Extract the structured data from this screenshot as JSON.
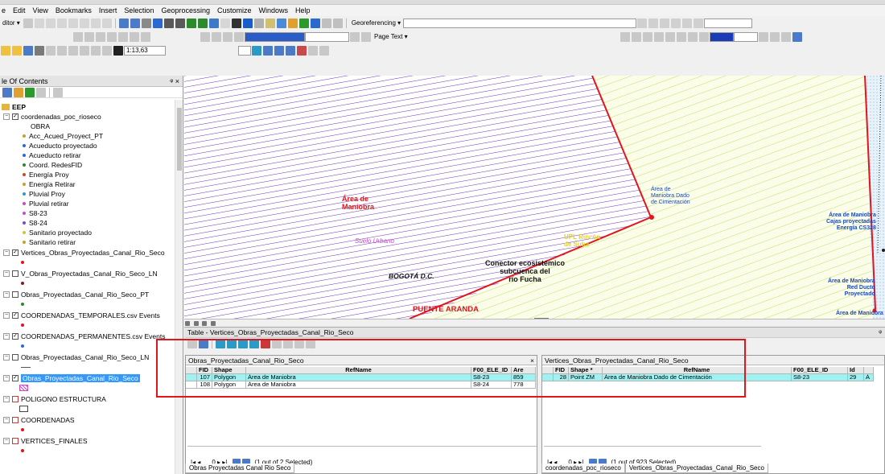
{
  "menu": [
    "e",
    "Edit",
    "View",
    "Bookmarks",
    "Insert",
    "Selection",
    "Geoprocessing",
    "Customize",
    "Windows",
    "Help"
  ],
  "toolbars": {
    "editor_label": "ditor ▾",
    "georef_label": "Georeferencing ▾",
    "page_text_label": "Page Text ▾",
    "scale": "1:13,63"
  },
  "toc": {
    "title": "le Of Contents",
    "pin": "ᵠ ×",
    "items": [
      {
        "text": "EEP"
      },
      {
        "text": "coordenadas_poc_rioseco"
      },
      {
        "text": "OBRA"
      },
      {
        "text": "Acc_Acued_Proyect_PT"
      },
      {
        "text": "Acueducto proyectado"
      },
      {
        "text": "Acueducto retirar"
      },
      {
        "text": "Coord. RedesFID"
      },
      {
        "text": "Energía Proy"
      },
      {
        "text": "Energía Retirar"
      },
      {
        "text": "Pluvial Proy"
      },
      {
        "text": "Pluvial retirar"
      },
      {
        "text": "S8-23"
      },
      {
        "text": "S8-24"
      },
      {
        "text": "Sanitario proyectado"
      },
      {
        "text": "Sanitario retirar"
      },
      {
        "text": "Vertices_Obras_Proyectadas_Canal_Rio_Seco"
      },
      {
        "text": "V_Obras_Proyectadas_Canal_Rio_Seco_LN"
      },
      {
        "text": "Obras_Proyectadas_Canal_Rio_Seco_PT"
      },
      {
        "text": "COORDENADAS_TEMPORALES.csv Events"
      },
      {
        "text": "COORDENADAS_PERMANENTES.csv Events"
      },
      {
        "text": "Obras_Proyectadas_Canal_Rio_Seco_LN"
      },
      {
        "text": "Obras_Proyectadas_Canal_Rio_Seco"
      },
      {
        "text": "POLIGONO ESTRUCTURA"
      },
      {
        "text": "COORDENADAS"
      },
      {
        "text": "VERTICES_FINALES"
      }
    ]
  },
  "map": {
    "labels": {
      "area_maniobra": "Área de\nManiobra",
      "suelo_urbano": "Suelo Urbano",
      "bogota": "BOGOTÁ D.C.",
      "conector": "Conector ecosistémico\nsubcuenca del\nrío Fucha",
      "puente_aranda": "PUENTE ARANDA",
      "area_dado": "Área de\nManiobra Dado\nde Cimentación",
      "area_cajas": "Área de Maniobra\nCajas proyectadas\nEnergía CS328",
      "area_red": "Área de Maniobra\nRed Ducto\nProyectado",
      "area_bottom": "Área de Maniobra",
      "yellow": "UPL Rincón\nde Suba"
    }
  },
  "table": {
    "title": "Table - Vertices_Obras_Proyectadas_Canal_Rio_Seco",
    "pin": "ᵠ",
    "left": {
      "tab": "Obras_Proyectadas_Canal_Rio_Seco",
      "close": "×",
      "headers": [
        "FID",
        "Shape",
        "RefName",
        "F00_ELE_ID",
        "Are"
      ],
      "rows": [
        [
          "107",
          "Polygon",
          "Área de Maniobra",
          "S8-23",
          "859"
        ],
        [
          "108",
          "Polygon",
          "Área de Maniobra",
          "S8-24",
          "778"
        ]
      ],
      "nav": "0 ▸ ▸|",
      "selected": "(1 out of 2 Selected)",
      "bottom_tab": "Obras Proyectadas Canal Rio Seco"
    },
    "right": {
      "tab": "Vertices_Obras_Proyectadas_Canal_Rio_Seco",
      "headers": [
        "FID",
        "Shape *",
        "RefName",
        "F00_ELE_ID",
        "Id",
        ""
      ],
      "rows": [
        [
          "28",
          "Point ZM",
          "Área de Maniobra Dado de Cimentación",
          "S8-23",
          "29",
          "Á"
        ]
      ],
      "nav": "0 ▸ ▸|",
      "selected": "(1 out of 923 Selected)",
      "bottom_tabs": [
        "coordenadas_poc_rioseco",
        "Vertices_Obras_Proyectadas_Canal_Rio_Seco"
      ]
    }
  },
  "colors": {
    "accent_red": "#e0161c",
    "hatch_purple": "#6f2fb8",
    "hatch_green": "#b8e06c",
    "highlight_cyan": "#9ff2f2",
    "selection_blue": "#3399ff"
  }
}
